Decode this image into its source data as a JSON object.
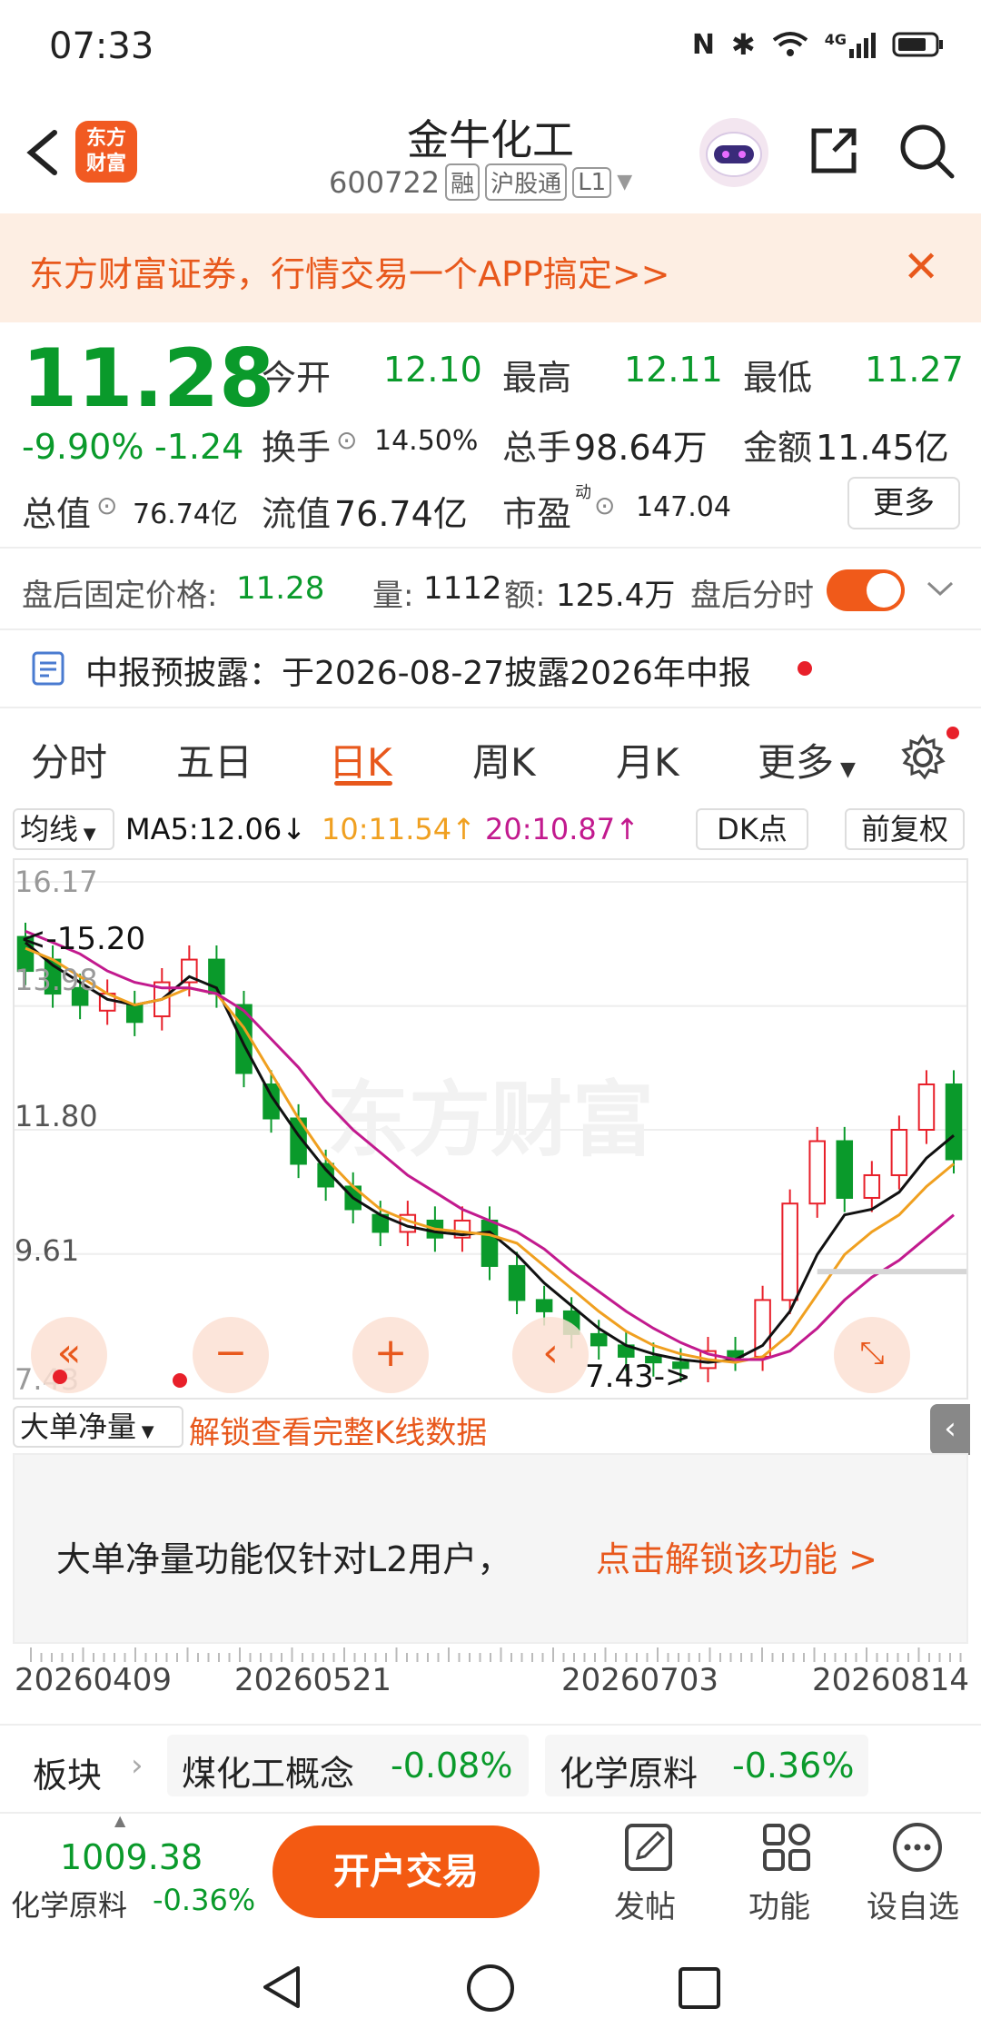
{
  "status": {
    "time": "07:33",
    "network": "4G"
  },
  "header": {
    "title": "金牛化工",
    "code": "600722",
    "tags": [
      "融",
      "沪股通",
      "L1"
    ],
    "logo_text": "东方财富"
  },
  "banner": {
    "text": "东方财富证券，行情交易一个APP搞定>>"
  },
  "quote": {
    "price": "11.28",
    "change_pct": "-9.90%",
    "change": "-1.24",
    "open_label": "今开",
    "open": "12.10",
    "high_label": "最高",
    "high": "12.11",
    "low_label": "最低",
    "low": "11.27",
    "turnover_label": "换手",
    "turnover": "14.50%",
    "volume_label": "总手",
    "volume": "98.64万",
    "amount_label": "金额",
    "amount": "11.45亿",
    "mktcap_label": "总值",
    "mktcap": "76.74亿",
    "float_label": "流值",
    "float": "76.74亿",
    "pe_label": "市盈",
    "pe_sup": "动",
    "pe": "147.04",
    "more": "更多"
  },
  "afterhours": {
    "price_label": "盘后固定价格:",
    "price": "11.28",
    "vol_label": "量:",
    "vol": "1112",
    "amt_label": "额:",
    "amt": "125.4万",
    "toggle_label": "盘后分时",
    "toggle_on": true
  },
  "notice": {
    "text": "中报预披露：于2026-08-27披露2026年中报"
  },
  "tabs": [
    "分时",
    "五日",
    "日K",
    "周K",
    "月K",
    "更多"
  ],
  "active_tab": "日K",
  "ma_bar": {
    "type": "均线",
    "ma5": "MA5:12.06↓",
    "ma10": "10:11.54↑",
    "ma20": "20:10.87↑",
    "dk": "DK点",
    "adj": "前复权"
  },
  "chart_data": {
    "type": "candlestick",
    "y_ticks": [
      "16.17",
      "13.98",
      "11.80",
      "9.61",
      "7.43"
    ],
    "annotations": [
      "<-15.20",
      "7.43->"
    ],
    "x_labels": [
      "20260409",
      "20260521",
      "20260703",
      "20260814"
    ],
    "ylim": [
      7.43,
      16.17
    ],
    "watermark": "东方财富",
    "colors": {
      "up": "#e8202a",
      "down": "#0a9a2b",
      "ma5": "#111111",
      "ma10": "#f0a020",
      "ma20": "#c21a8e"
    },
    "series": [
      {
        "name": "MA5",
        "values": [
          15.1,
          14.7,
          14.4,
          14.1,
          14.0,
          14.1,
          14.5,
          14.3,
          13.3,
          12.4,
          11.7,
          11.1,
          10.6,
          10.3,
          10.1,
          10.0,
          9.95,
          10.0,
          9.6,
          9.1,
          8.7,
          8.3,
          8.0,
          7.85,
          7.75,
          7.7,
          7.75,
          8.0,
          8.6,
          9.6,
          10.3,
          10.4,
          10.7,
          11.3,
          11.7
        ]
      },
      {
        "name": "MA10",
        "values": [
          15.0,
          14.8,
          14.5,
          14.2,
          14.0,
          14.1,
          14.3,
          14.2,
          13.6,
          12.8,
          12.0,
          11.3,
          10.8,
          10.4,
          10.2,
          10.05,
          10.0,
          9.95,
          9.8,
          9.4,
          9.0,
          8.6,
          8.25,
          8.0,
          7.85,
          7.75,
          7.7,
          7.8,
          8.2,
          8.9,
          9.6,
          10.0,
          10.3,
          10.8,
          11.2
        ]
      },
      {
        "name": "MA20",
        "values": [
          15.3,
          15.1,
          14.9,
          14.6,
          14.4,
          14.3,
          14.3,
          14.2,
          13.9,
          13.4,
          12.9,
          12.3,
          11.8,
          11.4,
          11.0,
          10.7,
          10.4,
          10.2,
          10.0,
          9.7,
          9.3,
          8.95,
          8.6,
          8.3,
          8.05,
          7.85,
          7.75,
          7.75,
          7.9,
          8.3,
          8.8,
          9.2,
          9.5,
          9.9,
          10.3
        ]
      }
    ],
    "candles": [
      {
        "o": 15.2,
        "c": 14.6
      },
      {
        "o": 14.8,
        "c": 14.2
      },
      {
        "o": 14.3,
        "c": 14.0
      },
      {
        "o": 13.9,
        "c": 14.2
      },
      {
        "o": 14.0,
        "c": 13.7
      },
      {
        "o": 13.8,
        "c": 14.4
      },
      {
        "o": 14.4,
        "c": 14.8
      },
      {
        "o": 14.8,
        "c": 14.2
      },
      {
        "o": 14.0,
        "c": 12.8
      },
      {
        "o": 12.6,
        "c": 12.0
      },
      {
        "o": 12.0,
        "c": 11.2
      },
      {
        "o": 11.2,
        "c": 10.8
      },
      {
        "o": 10.8,
        "c": 10.4
      },
      {
        "o": 10.3,
        "c": 10.0
      },
      {
        "o": 10.0,
        "c": 10.3
      },
      {
        "o": 10.2,
        "c": 9.9
      },
      {
        "o": 9.9,
        "c": 10.2
      },
      {
        "o": 10.2,
        "c": 9.4
      },
      {
        "o": 9.4,
        "c": 8.8
      },
      {
        "o": 8.8,
        "c": 8.6
      },
      {
        "o": 8.6,
        "c": 8.2
      },
      {
        "o": 8.2,
        "c": 8.0
      },
      {
        "o": 8.0,
        "c": 7.8
      },
      {
        "o": 7.8,
        "c": 7.7
      },
      {
        "o": 7.7,
        "c": 7.6
      },
      {
        "o": 7.6,
        "c": 7.9
      },
      {
        "o": 7.9,
        "c": 7.8
      },
      {
        "o": 7.8,
        "c": 8.8
      },
      {
        "o": 8.8,
        "c": 10.5
      },
      {
        "o": 10.5,
        "c": 11.6
      },
      {
        "o": 11.6,
        "c": 10.6
      },
      {
        "o": 10.6,
        "c": 11.0
      },
      {
        "o": 11.0,
        "c": 11.8
      },
      {
        "o": 11.8,
        "c": 12.6
      },
      {
        "o": 12.6,
        "c": 11.28
      }
    ]
  },
  "indicator": {
    "type": "大单净量",
    "unlock_link": "解锁查看完整K线数据",
    "msg": "大单净量功能仅针对L2用户，",
    "msg_link": "点击解锁该功能 >"
  },
  "sectors": {
    "label": "板块",
    "items": [
      {
        "name": "煤化工概念",
        "chg": "-0.08%"
      },
      {
        "name": "化学原料",
        "chg": "-0.36%"
      }
    ]
  },
  "bottom": {
    "index_val": "1009.38",
    "index_name": "化学原料",
    "index_chg": "-0.36%",
    "open_btn": "开户交易",
    "actions": [
      "发帖",
      "功能",
      "设自选"
    ]
  }
}
